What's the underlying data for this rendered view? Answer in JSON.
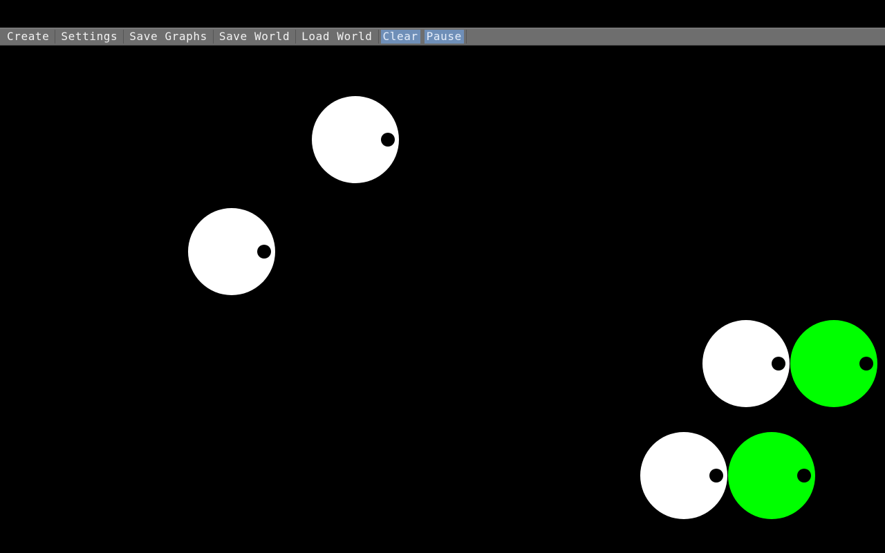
{
  "menu": {
    "items": [
      {
        "label": "Create",
        "active": false
      },
      {
        "label": "Settings",
        "active": false
      },
      {
        "label": "Save Graphs",
        "active": false
      },
      {
        "label": "Save World",
        "active": false
      },
      {
        "label": "Load World",
        "active": false
      },
      {
        "label": "Clear",
        "active": true
      },
      {
        "label": "Pause",
        "active": true
      }
    ]
  },
  "colors": {
    "background": "#000000",
    "menubar": "#6e6e6e",
    "menu_active": "#6f8fb8",
    "agent_white": "#ffffff",
    "agent_green": "#00ff00",
    "eye": "#000000"
  },
  "agents": [
    {
      "color": "white",
      "facing": "right"
    },
    {
      "color": "white",
      "facing": "right"
    },
    {
      "color": "white",
      "facing": "right"
    },
    {
      "color": "green",
      "facing": "right"
    },
    {
      "color": "white",
      "facing": "right"
    },
    {
      "color": "green",
      "facing": "right"
    }
  ]
}
